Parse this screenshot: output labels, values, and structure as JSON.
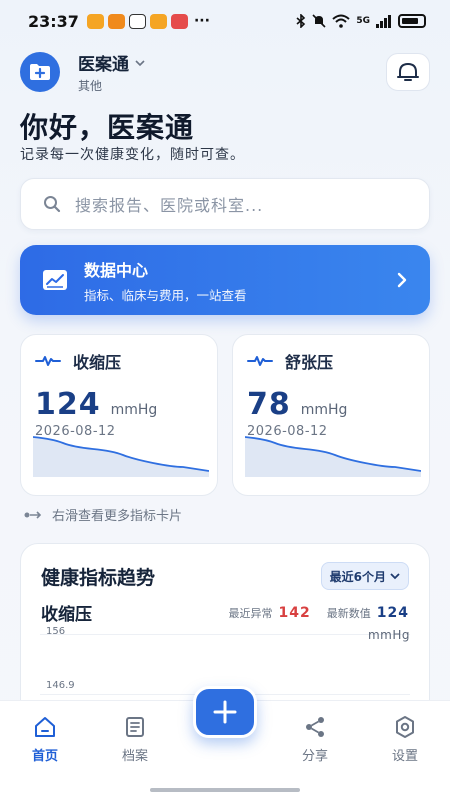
{
  "status_bar": {
    "time": "23:37",
    "more": "···",
    "network": "5G"
  },
  "header": {
    "app_name": "医案通",
    "profile_sub": "其他"
  },
  "greeting": {
    "title": "你好，医案通",
    "subtitle": "记录每一次健康变化，随时可查。"
  },
  "search": {
    "placeholder": "搜索报告、医院或科室..."
  },
  "data_center": {
    "title": "数据中心",
    "subtitle": "指标、临床与费用，一站查看"
  },
  "cards": [
    {
      "title": "收缩压",
      "value": "124",
      "unit": "mmHg",
      "date": "2026-08-12"
    },
    {
      "title": "舒张压",
      "value": "78",
      "unit": "mmHg",
      "date": "2026-08-12"
    }
  ],
  "swipe_hint": "右滑查看更多指标卡片",
  "trend": {
    "title": "健康指标趋势",
    "range": "最近6个月",
    "metric": "收缩压",
    "recent_abnormal_label": "最近异常",
    "recent_abnormal_value": "142",
    "latest_label": "最新数值",
    "latest_value": "124",
    "unit": "mmHg",
    "y_ticks": [
      "156",
      "146.9"
    ]
  },
  "tabs": [
    {
      "label": "首页",
      "icon": "home-icon",
      "active": true
    },
    {
      "label": "档案",
      "icon": "records-icon",
      "active": false
    },
    {
      "label": "分享",
      "icon": "share-icon",
      "active": false
    },
    {
      "label": "设置",
      "icon": "settings-icon",
      "active": false
    }
  ],
  "fab": {
    "icon": "plus-icon"
  },
  "colors": {
    "primary": "#2f6fe0",
    "value_blue": "#1a3f86",
    "abnormal_red": "#d84040"
  }
}
